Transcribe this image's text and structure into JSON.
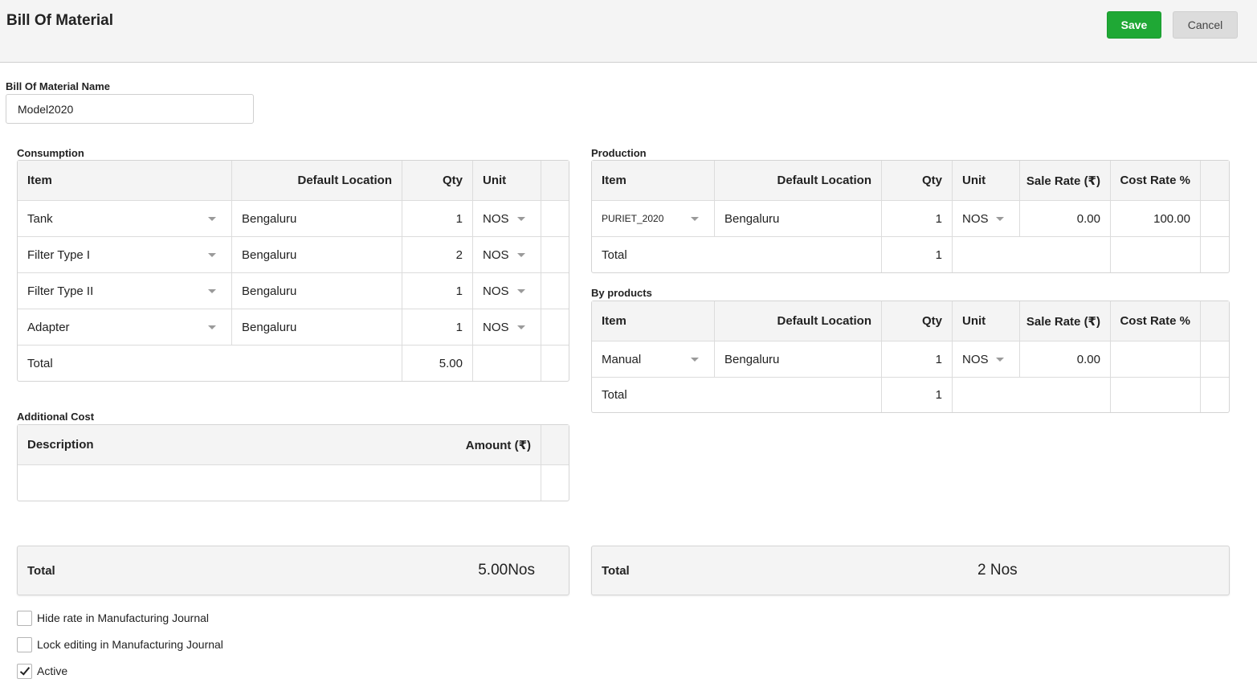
{
  "header": {
    "title": "Bill Of Material",
    "save_label": "Save",
    "cancel_label": "Cancel"
  },
  "bom_name": {
    "label": "Bill Of Material Name",
    "value": "Model2020"
  },
  "consumption": {
    "label": "Consumption",
    "headers": {
      "item": "Item",
      "location": "Default Location",
      "qty": "Qty",
      "unit": "Unit"
    },
    "rows": [
      {
        "item": "Tank",
        "location": "Bengaluru",
        "qty": "1",
        "unit": "NOS"
      },
      {
        "item": "Filter Type I",
        "location": "Bengaluru",
        "qty": "2",
        "unit": "NOS"
      },
      {
        "item": "Filter Type II",
        "location": "Bengaluru",
        "qty": "1",
        "unit": "NOS"
      },
      {
        "item": "Adapter",
        "location": "Bengaluru",
        "qty": "1",
        "unit": "NOS"
      }
    ],
    "total": {
      "label": "Total",
      "qty": "5.00"
    }
  },
  "additional_cost": {
    "label": "Additional Cost",
    "headers": {
      "description": "Description",
      "amount": "Amount (₹)"
    }
  },
  "production": {
    "label": "Production",
    "headers": {
      "item": "Item",
      "location": "Default Location",
      "qty": "Qty",
      "unit": "Unit",
      "sale_rate": "Sale Rate (₹)",
      "cost_rate": "Cost Rate %"
    },
    "rows": [
      {
        "item": "PURIET_2020",
        "location": "Bengaluru",
        "qty": "1",
        "unit": "NOS",
        "sale_rate": "0.00",
        "cost_rate": "100.00"
      }
    ],
    "total": {
      "label": "Total",
      "qty": "1"
    }
  },
  "by_products": {
    "label": "By products",
    "headers": {
      "item": "Item",
      "location": "Default Location",
      "qty": "Qty",
      "unit": "Unit",
      "sale_rate": "Sale Rate (₹)",
      "cost_rate": "Cost Rate %"
    },
    "rows": [
      {
        "item": "Manual",
        "location": "Bengaluru",
        "qty": "1",
        "unit": "NOS",
        "sale_rate": "0.00",
        "cost_rate": ""
      }
    ],
    "total": {
      "label": "Total",
      "qty": "1"
    }
  },
  "summary": {
    "consumption_total_label": "Total",
    "consumption_total_value": "5.00Nos",
    "production_total_label": "Total",
    "production_total_value": "2 Nos"
  },
  "options": [
    {
      "label": "Hide rate in Manufacturing Journal",
      "checked": false
    },
    {
      "label": "Lock editing in Manufacturing Journal",
      "checked": false
    },
    {
      "label": "Active",
      "checked": true
    }
  ],
  "colors": {
    "save": "#1fa835",
    "header_bg": "#f4f4f4",
    "border": "#d4d4d4"
  }
}
